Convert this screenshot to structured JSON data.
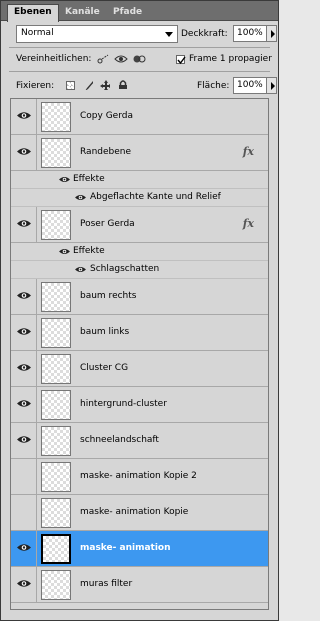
{
  "tabs": [
    {
      "label": "Ebenen"
    },
    {
      "label": "Kanäle"
    },
    {
      "label": "Pfade"
    }
  ],
  "blend_mode": "Normal",
  "opacity": {
    "label": "Deckkraft:",
    "value": "100%"
  },
  "unify": {
    "label": "Vereinheitlichen:"
  },
  "propagate": {
    "label": "Frame 1 propagier",
    "checked": true
  },
  "lock": {
    "label": "Fixieren:"
  },
  "fill": {
    "label": "Fläche:",
    "value": "100%"
  },
  "layers": [
    {
      "name": "Copy Gerda",
      "visible": true,
      "fx": false,
      "selected": false
    },
    {
      "name": "Randebene",
      "visible": true,
      "fx": true,
      "selected": false,
      "effects_label": "Effekte",
      "effects": [
        "Abgeflachte Kante und Relief"
      ]
    },
    {
      "name": "Poser Gerda",
      "visible": true,
      "fx": true,
      "selected": false,
      "effects_label": "Effekte",
      "effects": [
        "Schlagschatten"
      ]
    },
    {
      "name": "baum rechts",
      "visible": true,
      "fx": false,
      "selected": false
    },
    {
      "name": "baum links",
      "visible": true,
      "fx": false,
      "selected": false
    },
    {
      "name": "Cluster CG",
      "visible": true,
      "fx": false,
      "selected": false
    },
    {
      "name": "hintergrund-cluster",
      "visible": true,
      "fx": false,
      "selected": false
    },
    {
      "name": "schneelandschaft",
      "visible": true,
      "fx": false,
      "selected": false
    },
    {
      "name": "maske- animation Kopie 2",
      "visible": false,
      "fx": false,
      "selected": false
    },
    {
      "name": "maske- animation Kopie",
      "visible": false,
      "fx": false,
      "selected": false
    },
    {
      "name": "maske- animation",
      "visible": true,
      "fx": false,
      "selected": true
    },
    {
      "name": "muras filter",
      "visible": true,
      "fx": false,
      "selected": false
    }
  ],
  "fx_symbol": "fx",
  "colors": {
    "selection": "#3d98f0",
    "panel": "#d6d6d6",
    "tabbar": "#6e6e6e"
  }
}
